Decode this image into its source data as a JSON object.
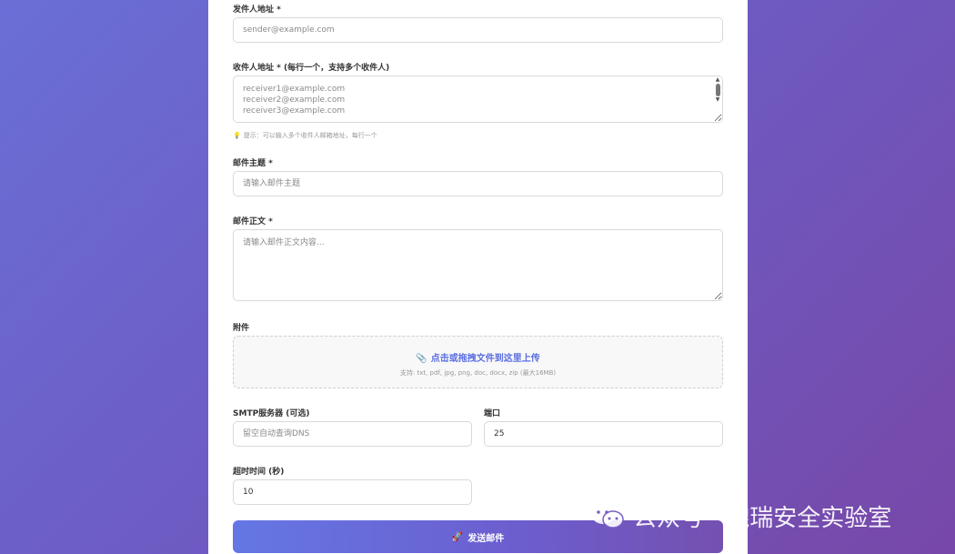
{
  "form": {
    "sender": {
      "label": "发件人地址 *",
      "placeholder": "sender@example.com"
    },
    "recipients": {
      "label": "收件人地址 * (每行一个，支持多个收件人)",
      "placeholder": "receiver1@example.com\nreceiver2@example.com\nreceiver3@example.com",
      "hint_icon": "💡",
      "hint": "提示：可以输入多个收件人邮箱地址，每行一个"
    },
    "subject": {
      "label": "邮件主题 *",
      "placeholder": "请输入邮件主题"
    },
    "body": {
      "label": "邮件正文 *",
      "placeholder": "请输入邮件正文内容..."
    },
    "attachment": {
      "label": "附件",
      "icon": "paperclip-icon",
      "icon_glyph": "📎",
      "title": "点击或拖拽文件到这里上传",
      "subtitle": "支持: txt, pdf, jpg, png, doc, docx, zip (最大16MB)"
    },
    "smtp": {
      "label": "SMTP服务器 (可选)",
      "placeholder": "留空自动查询DNS"
    },
    "port": {
      "label": "端口",
      "value": "25"
    },
    "timeout": {
      "label": "超时时间 (秒)",
      "value": "10"
    },
    "send_button": {
      "icon_glyph": "🚀",
      "label": "发送邮件"
    }
  },
  "watermark": {
    "icon": "wechat-icon",
    "text_left": "公众号",
    "separator": "·",
    "text_right": "貔瑞安全实验室"
  },
  "colors": {
    "accent": "#5b6ee1",
    "background_start": "#6a6fd6",
    "background_end": "#7748a8"
  }
}
